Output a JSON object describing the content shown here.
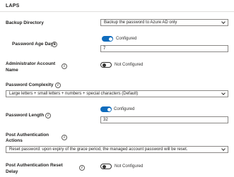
{
  "section": {
    "title": "LAPS"
  },
  "backup_directory": {
    "label": "Backup Directory",
    "value": "Backup the password to Azure AD only"
  },
  "password_age_days": {
    "label": "Password Age Days",
    "toggle_label": "Configured",
    "toggle_on": true,
    "value": "7"
  },
  "administrator_account_name": {
    "label_line1": "Administrator Account",
    "label_line2": "Name",
    "toggle_label": "Not Configured",
    "toggle_on": false
  },
  "password_complexity": {
    "label": "Password Complexity",
    "value": "Large letters + small letters + numbers + special characters (Default)"
  },
  "password_length": {
    "label": "Password Length",
    "toggle_label": "Configured",
    "toggle_on": true,
    "value": "32"
  },
  "post_authentication_actions": {
    "label_line1": "Post Authentication",
    "label_line2": "Actions",
    "value": "Reset password: upon expiry of the grace period, the managed account password will be reset."
  },
  "post_authentication_reset_delay": {
    "label_line1": "Post Authentication Reset",
    "label_line2": "Delay",
    "toggle_label": "Not Configured",
    "toggle_on": false
  },
  "colors": {
    "accent": "#0f6cbd",
    "border": "#8a8886",
    "divider": "#e1dfdd"
  },
  "icons": {
    "info": "info-icon",
    "chevron": "chevron-down-icon"
  }
}
